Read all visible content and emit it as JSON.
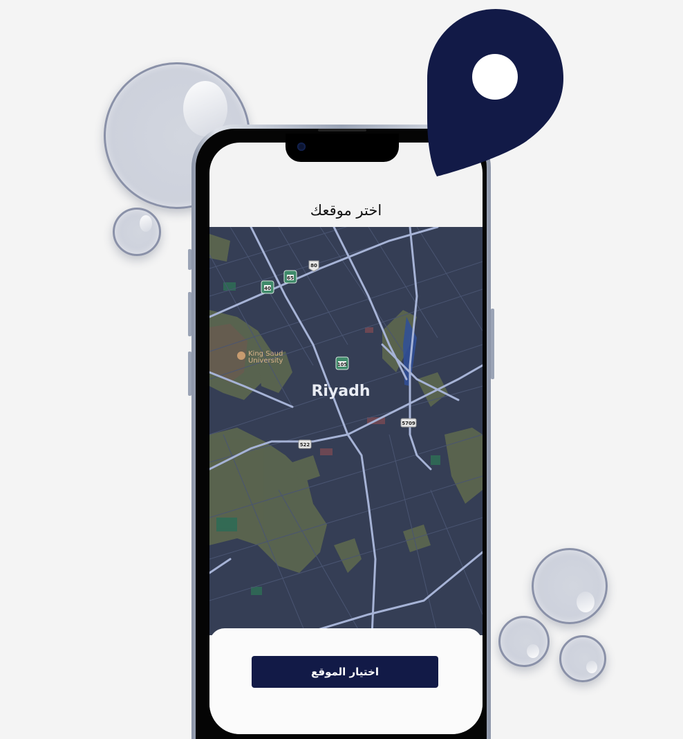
{
  "screen": {
    "title": "اختر موقعك",
    "select_button_label": "اختيار الموقع"
  },
  "map": {
    "city_label": "Riyadh",
    "poi_label_line1": "King Saud",
    "poi_label_line2": "University",
    "road_shields": [
      "40",
      "65",
      "80",
      "105",
      "5709",
      "522"
    ]
  },
  "colors": {
    "accent": "#121a47",
    "map_background": "#353e55",
    "background": "#f4f4f4"
  },
  "icons": [
    "location-pin-icon",
    "university-icon"
  ]
}
